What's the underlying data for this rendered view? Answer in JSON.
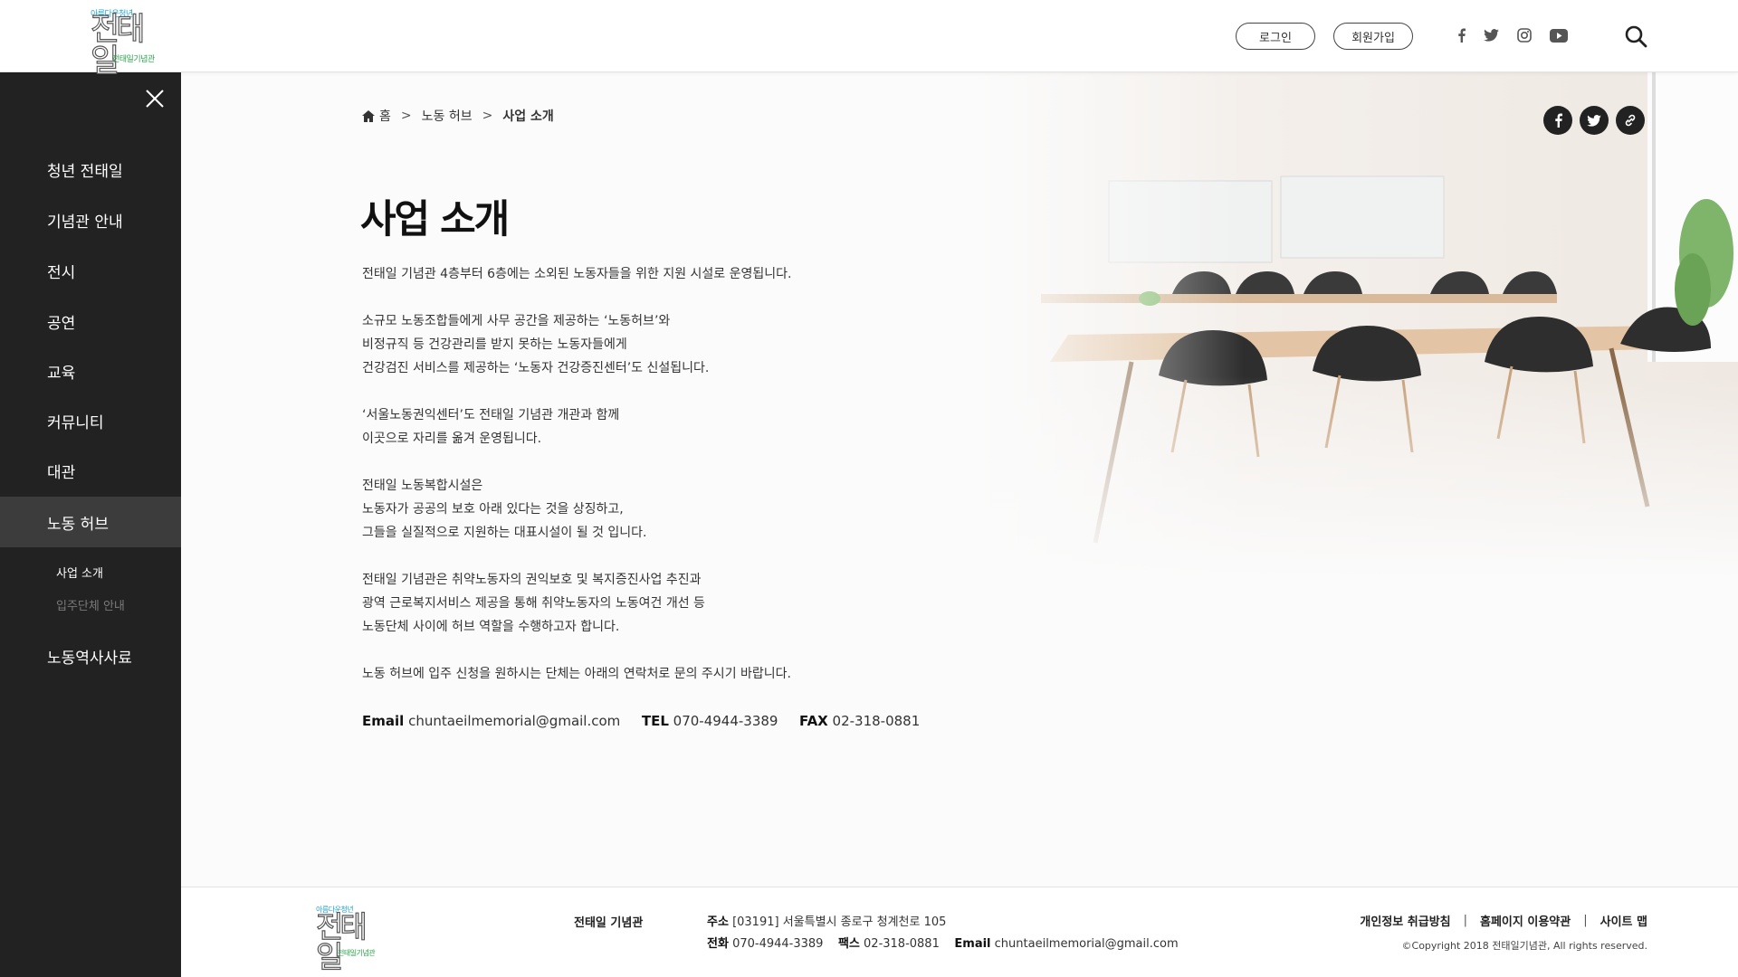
{
  "header": {
    "logo": {
      "tagline": "아름다운청년",
      "mark": "전태일",
      "sub": "전태일기념관"
    },
    "login_label": "로그인",
    "join_label": "회원가입",
    "sns": [
      "facebook-icon",
      "twitter-icon",
      "instagram-icon",
      "youtube-icon"
    ]
  },
  "sidebar": {
    "items": [
      {
        "label": "청년 전태일"
      },
      {
        "label": "기념관 안내"
      },
      {
        "label": "전시"
      },
      {
        "label": "공연"
      },
      {
        "label": "교육"
      },
      {
        "label": "커뮤니티"
      },
      {
        "label": "대관"
      },
      {
        "label": "노동 허브",
        "active": true
      },
      {
        "label": "노동역사사료"
      }
    ],
    "subitems": [
      {
        "label": "사업 소개",
        "active": true
      },
      {
        "label": "입주단체 안내",
        "active": false
      }
    ]
  },
  "breadcrumb": {
    "home": "홈",
    "sep": ">",
    "level1": "노동 허브",
    "current": "사업 소개"
  },
  "page": {
    "title": "사업 소개",
    "paragraphs": [
      [
        "전태일 기념관 4층부터 6층에는 소외된 노동자들을 위한 지원 시설로 운영됩니다."
      ],
      [
        "소규모 노동조합들에게 사무 공간을 제공하는 ‘노동허브’와",
        "비정규직 등 건강관리를 받지 못하는 노동자들에게",
        "건강검진 서비스를 제공하는 ‘노동자 건강증진센터’도 신설됩니다."
      ],
      [
        "‘서울노동권익센터’도 전태일 기념관 개관과 함께",
        "이곳으로 자리를 옮겨 운영됩니다."
      ],
      [
        "전태일 노동복합시설은",
        "노동자가 공공의 보호 아래 있다는 것을 상징하고,",
        "그들을 실질적으로 지원하는 대표시설이 될 것 입니다."
      ],
      [
        "전태일 기념관은 취약노동자의 권익보호 및 복지증진사업 추진과",
        "광역 근로복지서비스 제공을 통해 취약노동자의 노동여건 개선 등",
        "노동단체 사이에 허브 역할을  수행하고자 합니다."
      ],
      [
        "노동 허브에 입주 신청을 원하시는 단체는 아래의 연락처로 문의 주시기 바랍니다."
      ]
    ],
    "contact": {
      "email_label": "Email",
      "email": "chuntaeilmemorial@gmail.com",
      "tel_label": "TEL",
      "tel": "070-4944-3389",
      "fax_label": "FAX",
      "fax": "02-318-0881"
    }
  },
  "footer": {
    "org_name": "전태일 기념관",
    "address_label": "주소",
    "address": "[03191] 서울특별시 종로구 청계천로 105",
    "phone_label": "전화",
    "phone": "070-4944-3389",
    "fax_label": "팩스",
    "fax": "02-318-0881",
    "email_label": "Email",
    "email": "chuntaeilmemorial@gmail.com",
    "links": [
      "개인정보 취급방침",
      "홈페이지 이용약관",
      "사이트 맵"
    ],
    "link_sep": "|",
    "copyright": "©Copyright 2018 전태일기념관, All rights reserved."
  },
  "colors": {
    "sidebar_bg": "#222222",
    "sidebar_active": "#3c3c3c",
    "logo_blue": "#1fa4d8",
    "logo_green": "#2aa64b"
  }
}
